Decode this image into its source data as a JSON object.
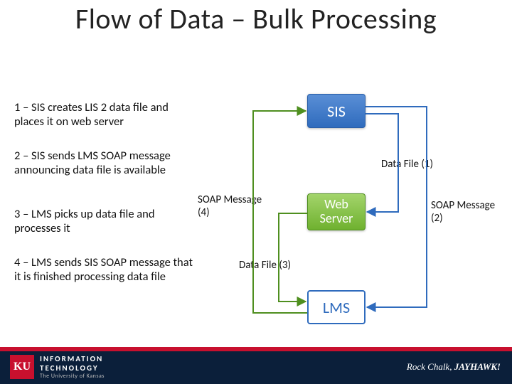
{
  "title": "Flow of Data – Bulk Processing",
  "steps": {
    "s1": "1 – SIS creates LIS 2 data file and places it on web server",
    "s2": "2 – SIS sends LMS SOAP message announcing data file is available",
    "s3": "3 – LMS picks up data file and processes it",
    "s4": "4 – LMS sends SIS SOAP message that it is finished processing data file"
  },
  "nodes": {
    "sis": "SIS",
    "web": "Web Server",
    "lms": "LMS"
  },
  "labels": {
    "data_file_1": "Data File (1)",
    "soap_msg_2": "SOAP Message (2)",
    "data_file_3": "Data File (3)",
    "soap_msg_4": "SOAP Message (4)"
  },
  "footer": {
    "ku": "KU",
    "it1": "INFORMATION",
    "it2": "TECHNOLOGY",
    "it3": "The University of Kansas",
    "right_pre": "Rock Chalk, ",
    "right_bold": "JAYHAWK!"
  },
  "colors": {
    "blue": "#2f6bbd",
    "green": "#6fb12f",
    "red": "#c8102e",
    "dark": "#0b1f3a"
  }
}
